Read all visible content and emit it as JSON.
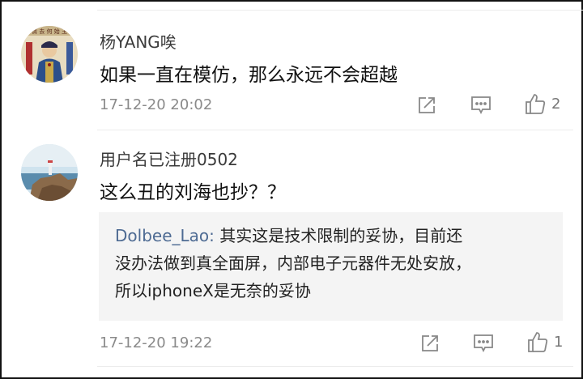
{
  "comments": [
    {
      "username": "杨YANG唉",
      "text": "如果一直在模仿，那么永远不会超越",
      "time": "17-12-20 20:02",
      "like_count": "2",
      "avatar": "portrait-avatar"
    },
    {
      "username": "用户名已注册0502",
      "text": "这么丑的刘海也抄？？",
      "time": "17-12-20 19:22",
      "like_count": "1",
      "avatar": "lighthouse-coast-avatar",
      "reply": {
        "author": "Dolbee_Lao:",
        "line1": "其实这是技术限制的妥协，目前还",
        "line2": "没办法做到真全面屏，内部电子元器件无处安放，",
        "line3": "所以iphoneX是无奈的妥协"
      }
    }
  ],
  "icons": [
    "share-icon",
    "comment-icon",
    "like-icon"
  ],
  "colors": {
    "reply_author": "#4e6b93",
    "reply_bg": "#f4f4f4",
    "meta_text": "#8a8a8a"
  }
}
